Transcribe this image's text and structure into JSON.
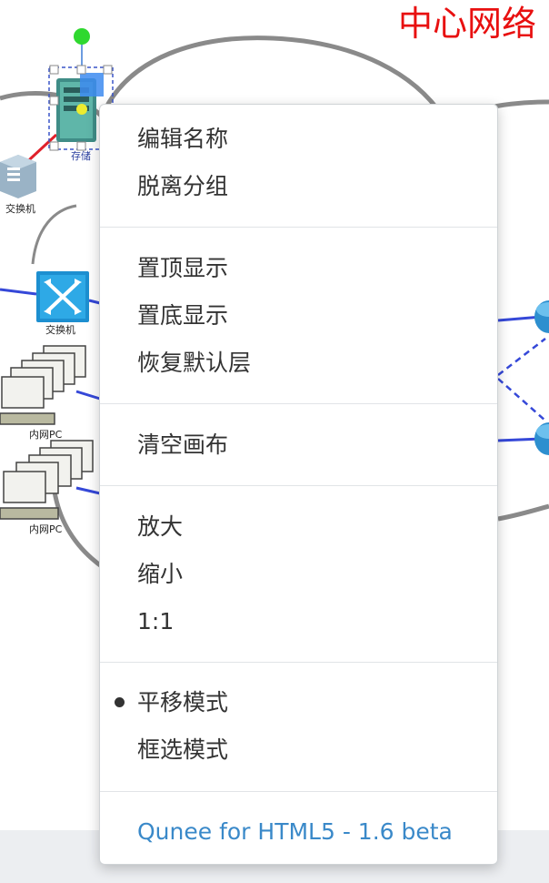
{
  "canvas": {
    "title": "中心网络",
    "nodes": [
      {
        "label": "存储"
      },
      {
        "label": "交换机"
      },
      {
        "label": "交换机"
      },
      {
        "label": "内网PC"
      },
      {
        "label": "内网PC"
      }
    ]
  },
  "menu": {
    "groups": [
      {
        "items": [
          {
            "label": "编辑名称"
          },
          {
            "label": "脱离分组"
          }
        ]
      },
      {
        "items": [
          {
            "label": "置顶显示"
          },
          {
            "label": "置底显示"
          },
          {
            "label": "恢复默认层"
          }
        ]
      },
      {
        "items": [
          {
            "label": "清空画布"
          }
        ]
      },
      {
        "items": [
          {
            "label": "放大"
          },
          {
            "label": "缩小"
          },
          {
            "label": "1:1"
          }
        ]
      },
      {
        "items": [
          {
            "label": "平移模式",
            "selected": true
          },
          {
            "label": "框选模式",
            "selected": false
          }
        ]
      },
      {
        "items": [
          {
            "label": "Qunee for HTML5 - 1.6 beta"
          }
        ]
      }
    ]
  },
  "colors": {
    "title": "#e81010",
    "link_blue": "#3a89c9",
    "edge_blue": "#3548d8",
    "edge_red": "#e0202a",
    "cloud_stroke": "#8a8a8a"
  }
}
